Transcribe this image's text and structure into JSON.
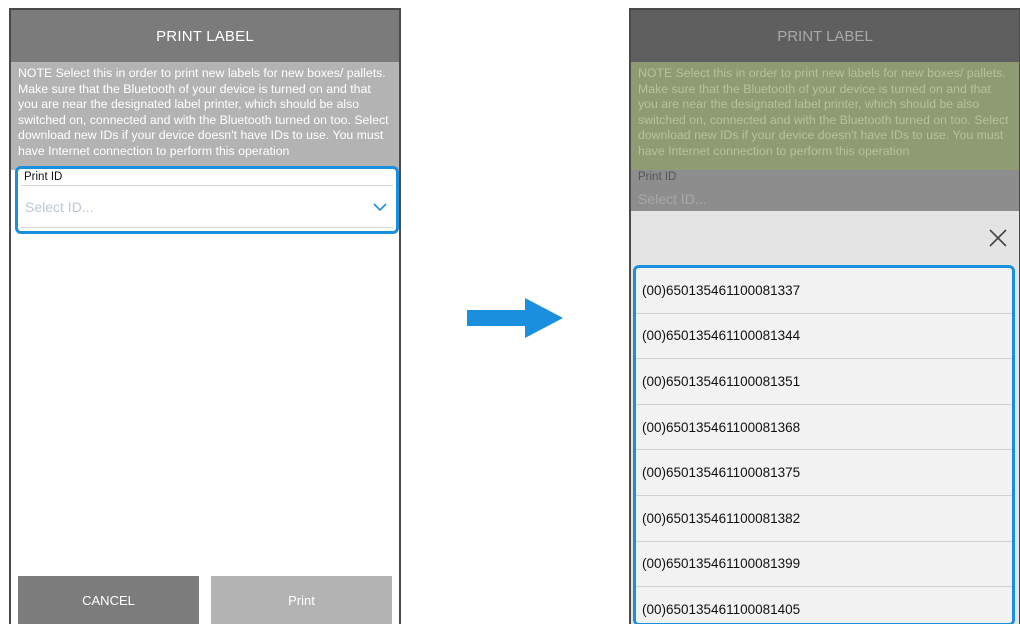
{
  "left_screen": {
    "header_title": "PRINT LABEL",
    "note": "NOTE Select this in order to print new labels for new boxes/ pallets. Make sure that the Bluetooth of your device is turned on and that you are near the designated label printer, which should be also switched on, connected and with the Bluetooth turned on too. Select download new IDs if your device doesn't have IDs to use. You must have Internet connection to perform this operation",
    "field_label": "Print ID",
    "field_placeholder": "Select ID...",
    "cancel_label": "CANCEL",
    "print_label": "Print"
  },
  "right_screen": {
    "header_title": "PRINT LABEL",
    "note": "NOTE Select this in order to print new labels for new boxes/ pallets. Make sure that the Bluetooth of your device is turned on and that you are near the designated label printer, which should be also switched on, connected and with the Bluetooth turned on too. Select download new IDs if your device doesn't have IDs to use. You must have Internet connection to perform this operation",
    "field_label": "Print ID",
    "field_placeholder": "Select ID...",
    "ids": [
      "(00)650135461100081337",
      "(00)650135461100081344",
      "(00)650135461100081351",
      "(00)650135461100081368",
      "(00)650135461100081375",
      "(00)650135461100081382",
      "(00)650135461100081399",
      "(00)650135461100081405"
    ]
  },
  "icons": {
    "dropdown": "chevron-down-icon",
    "close": "close-icon",
    "transition": "arrow-right-icon"
  },
  "colors": {
    "accent": "#1a8fde",
    "header": "#7b7b7b",
    "note_bg": "#b3b3b3"
  }
}
